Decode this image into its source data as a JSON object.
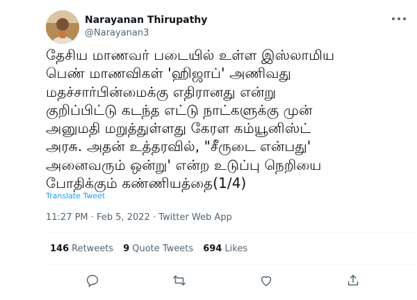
{
  "author": {
    "display_name": "Narayanan Thirupathy",
    "handle": "@Narayanan3"
  },
  "tweet": {
    "text": "தேசிய மாணவர் படையில் உள்ள இஸ்லாமிய\nபெண் மாணவிகள் 'ஹிஜாப்' அணிவது\nமதச்சார்பின்மைக்கு எதிரானது என்று\nகுறிப்பிட்டு  கடந்த எட்டு நாட்களுக்கு முன்\nஅனுமதி மறுத்துள்ளது  கேரள கம்யூனிஸ்ட்\nஅரசு. அதன் உத்தரவில், \"சீருடை என்பது'\nஅனைவரும் ஒன்று' என்ற உடுப்பு நெறியை\nபோதிக்கும் கண்ணியத்தை(1/4)",
    "translate_label": "Translate Tweet",
    "meta": "11:27 PM · Feb 5, 2022 · Twitter Web App"
  },
  "stats": {
    "retweets_count": "146",
    "retweets_label": "Retweets",
    "quotes_count": "9",
    "quotes_label": "Quote Tweets",
    "likes_count": "694",
    "likes_label": "Likes"
  },
  "icons": [
    "more-icon",
    "reply-icon",
    "retweet-icon",
    "like-icon",
    "share-icon"
  ],
  "colors": {
    "accent": "#1d9bf0",
    "secondary_text": "#536471",
    "divider": "#eff3f4"
  }
}
